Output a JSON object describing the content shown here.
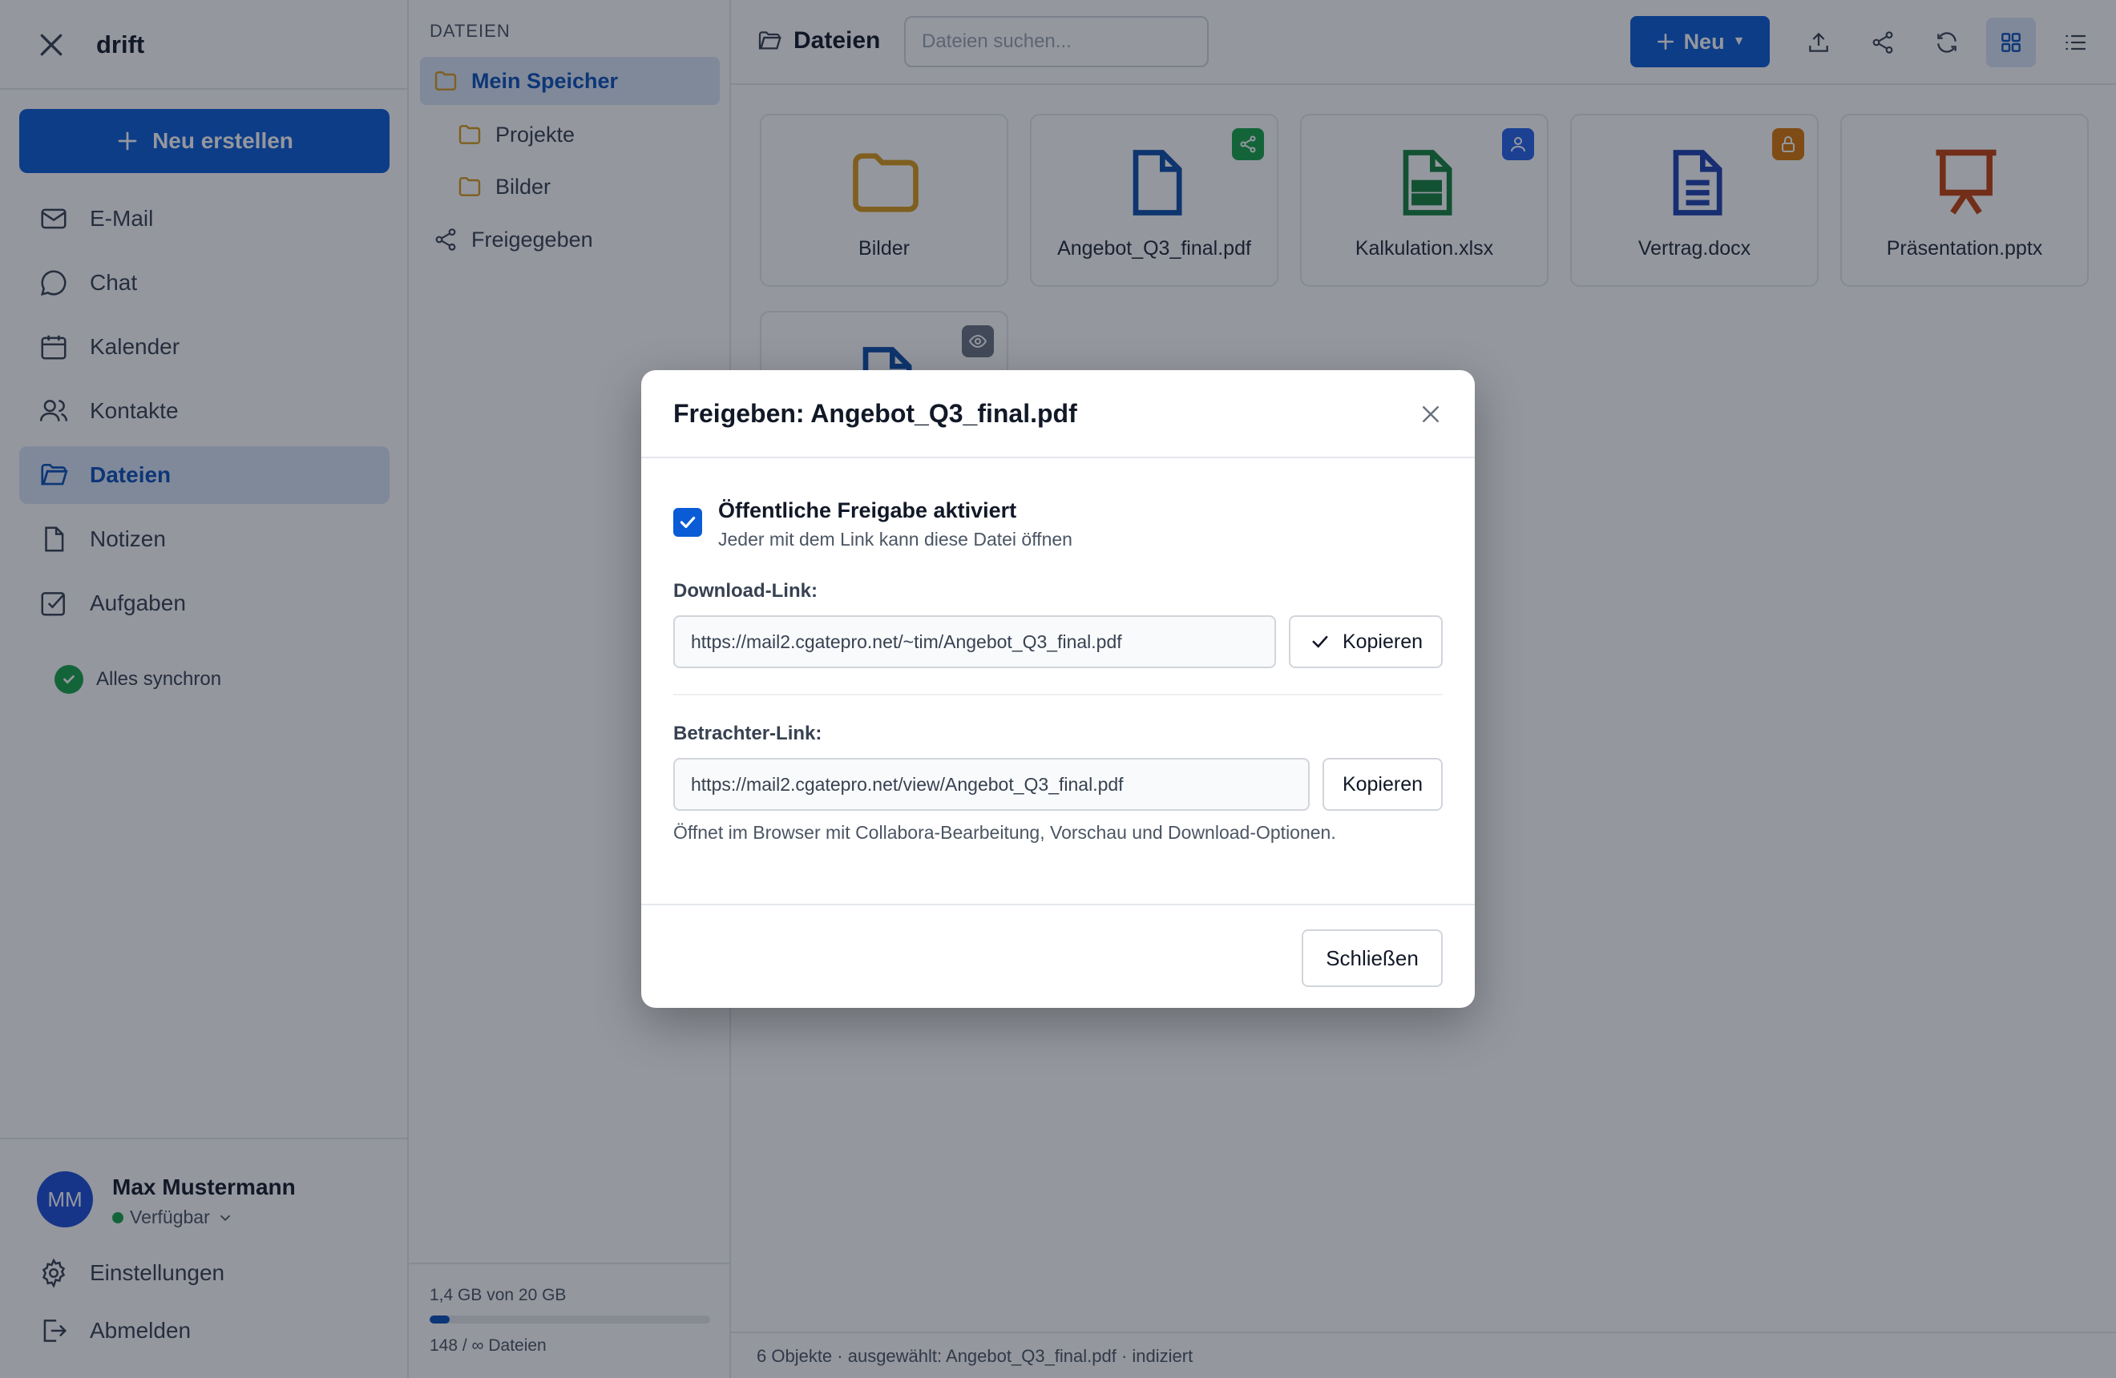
{
  "sidebar": {
    "brand": "drift",
    "new_button": "Neu erstellen",
    "items": [
      {
        "label": "E-Mail",
        "icon": "mail-icon"
      },
      {
        "label": "Chat",
        "icon": "chat-icon"
      },
      {
        "label": "Kalender",
        "icon": "calendar-icon"
      },
      {
        "label": "Kontakte",
        "icon": "contacts-icon"
      },
      {
        "label": "Dateien",
        "icon": "folder-icon"
      },
      {
        "label": "Notizen",
        "icon": "note-icon"
      },
      {
        "label": "Aufgaben",
        "icon": "task-icon"
      }
    ],
    "active_item": "Dateien",
    "sync_status": "Alles synchron",
    "user": {
      "initials": "MM",
      "name": "Max Mustermann",
      "status": "Verfügbar"
    },
    "settings": "Einstellungen",
    "logout": "Abmelden"
  },
  "folders": {
    "title": "DATEIEN",
    "root": "Mein Speicher",
    "children": [
      "Projekte",
      "Bilder"
    ],
    "shared": "Freigegeben",
    "storage_text": "1,4 GB von 20 GB",
    "storage_used_fraction": 0.07,
    "files_count": "148 / ∞ Dateien"
  },
  "toolbar": {
    "title": "Dateien",
    "search_placeholder": "Dateien suchen...",
    "new_button": "Neu"
  },
  "files": [
    {
      "name": "Bilder",
      "type": "folder",
      "badge": null
    },
    {
      "name": "Angebot_Q3_final.pdf",
      "type": "pdf",
      "badge": "share"
    },
    {
      "name": "Kalkulation.xlsx",
      "type": "xlsx",
      "badge": "user"
    },
    {
      "name": "Vertrag.docx",
      "type": "docx",
      "badge": "lock"
    },
    {
      "name": "Präsentation.pptx",
      "type": "pptx",
      "badge": null
    },
    {
      "name": "",
      "type": "file",
      "badge": "view"
    }
  ],
  "statusbar": "6 Objekte · ausgewählt: Angebot_Q3_final.pdf · indiziert",
  "modal": {
    "title": "Freigeben: Angebot_Q3_final.pdf",
    "public_share_label": "Öffentliche Freigabe aktiviert",
    "public_share_checked": true,
    "public_share_desc": "Jeder mit dem Link kann diese Datei öffnen",
    "download_label": "Download-Link:",
    "download_url": "https://mail2.cgatepro.net/~tim/Angebot_Q3_final.pdf",
    "viewer_label": "Betrachter-Link:",
    "viewer_url": "https://mail2.cgatepro.net/view/Angebot_Q3_final.pdf",
    "copy_label": "Kopieren",
    "hint": "Öffnet im Browser mit Collabora-Bearbeitung, Vorschau und Download-Optionen.",
    "close_label": "Schließen"
  },
  "colors": {
    "accent": "#0a5bd6",
    "folder": "#d99a1b",
    "pdf": "#0b4ea8",
    "xlsx": "#15803d",
    "docx": "#1e40af",
    "pptx": "#c2410c",
    "badge_share": "#16a34a",
    "badge_user": "#2563eb",
    "badge_lock": "#d97706",
    "badge_view": "#6b7280"
  }
}
